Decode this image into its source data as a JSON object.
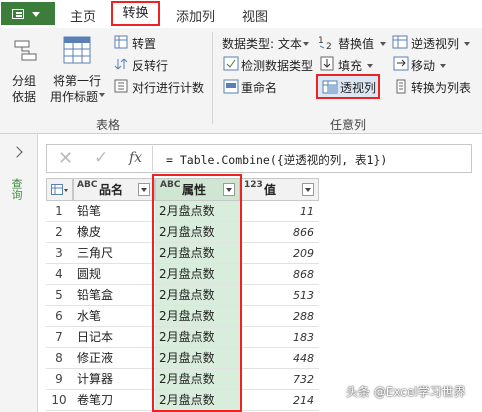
{
  "tabs": {
    "home": "主页",
    "transform": "转换",
    "add_column": "添加列",
    "view": "视图"
  },
  "ribbon": {
    "table_group": {
      "group_by": [
        "分组",
        "依据"
      ],
      "first_row_header": [
        "将第一行",
        "用作标题"
      ],
      "transpose": "转置",
      "reverse_rows": "反转行",
      "count_rows": "对行进行计数",
      "label": "表格"
    },
    "any_column_group": {
      "data_type": "数据类型: 文本",
      "replace_values": "替换值",
      "unpivot": "逆透视列",
      "detect_type": "检测数据类型",
      "fill": "填充",
      "move": "移动",
      "rename": "重命名",
      "pivot": "透视列",
      "to_list": "转换为列表",
      "label": "任意列"
    }
  },
  "rail": {
    "label": "查询"
  },
  "formula_bar": {
    "x": "✕",
    "check": "✓",
    "fx": "fx",
    "expression": "= Table.Combine({逆透视的列, 表1})"
  },
  "grid": {
    "columns": [
      {
        "type": "ABC",
        "name": "品名"
      },
      {
        "type": "ABC",
        "name": "属性"
      },
      {
        "type": "123",
        "name": "值"
      }
    ],
    "rows": [
      {
        "n": "1",
        "name": "铅笔",
        "attr": "2月盘点数",
        "value": "11"
      },
      {
        "n": "2",
        "name": "橡皮",
        "attr": "2月盘点数",
        "value": "866"
      },
      {
        "n": "3",
        "name": "三角尺",
        "attr": "2月盘点数",
        "value": "209"
      },
      {
        "n": "4",
        "name": "圆规",
        "attr": "2月盘点数",
        "value": "868"
      },
      {
        "n": "5",
        "name": "铅笔盒",
        "attr": "2月盘点数",
        "value": "513"
      },
      {
        "n": "6",
        "name": "水笔",
        "attr": "2月盘点数",
        "value": "288"
      },
      {
        "n": "7",
        "name": "日记本",
        "attr": "2月盘点数",
        "value": "183"
      },
      {
        "n": "8",
        "name": "修正液",
        "attr": "2月盘点数",
        "value": "448"
      },
      {
        "n": "9",
        "name": "计算器",
        "attr": "2月盘点数",
        "value": "732"
      },
      {
        "n": "10",
        "name": "卷笔刀",
        "attr": "2月盘点数",
        "value": "214"
      }
    ]
  },
  "watermark": "头条 @Excel学习世界",
  "colors": {
    "accent": "#3c7d3c",
    "highlight_border": "#e22222",
    "attr_fill": "#d9eddc"
  }
}
